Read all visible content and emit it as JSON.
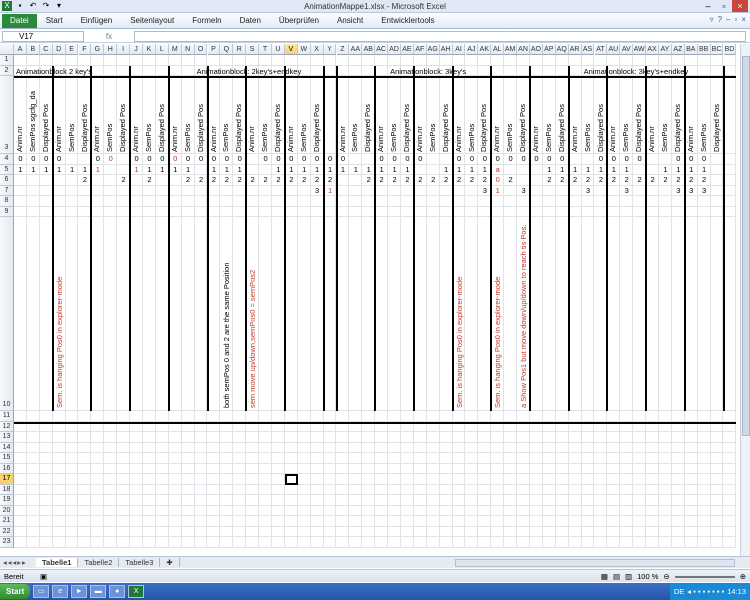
{
  "window": {
    "title": "AnimationMappe1.xlsx - Microsoft Excel"
  },
  "ribbon": {
    "file_label": "Datei",
    "tabs": [
      "Start",
      "Einfügen",
      "Seitenlayout",
      "Formeln",
      "Daten",
      "Überprüfen",
      "Ansicht",
      "Entwicklertools"
    ]
  },
  "formula_bar": {
    "name_box": "V17",
    "fx_label": "fx",
    "formula": ""
  },
  "sheet": {
    "selected_column": "V",
    "selected_row": "17",
    "columns": [
      "A",
      "B",
      "C",
      "D",
      "E",
      "F",
      "G",
      "H",
      "I",
      "J",
      "K",
      "L",
      "M",
      "N",
      "O",
      "P",
      "Q",
      "R",
      "S",
      "T",
      "U",
      "V",
      "W",
      "X",
      "Y",
      "Z",
      "AA",
      "AB",
      "AC",
      "AD",
      "AE",
      "AF",
      "AG",
      "AH",
      "AI",
      "AJ",
      "AK",
      "AL",
      "AM",
      "AN",
      "AO",
      "AP",
      "AQ",
      "AR",
      "AS",
      "AT",
      "AU",
      "AV",
      "AW",
      "AX",
      "AY",
      "AZ",
      "BA",
      "BB",
      "BC",
      "BD"
    ],
    "rows": [
      "1",
      "2",
      "3",
      "4",
      "5",
      "6",
      "7",
      "8",
      "9",
      "10",
      "11",
      "12",
      "13",
      "14",
      "15",
      "16",
      "17",
      "18",
      "19",
      "20",
      "21",
      "22",
      "23"
    ],
    "block_titles": [
      {
        "label": "Animationblock  2 key's"
      },
      {
        "label": "Animationblock: 2key's+endkey"
      },
      {
        "label": "Animationblock: 3key's"
      },
      {
        "label": "Animationblock: 3key's+endkey"
      }
    ],
    "header_labels": [
      "Anim.nr",
      "SemPos sgcfg_da",
      "Displayed Pos",
      "Anim.nr",
      "SemPos",
      "Displayed Pos",
      "Anim.nr",
      "SemPos",
      "Displayed Pos",
      "Anim.nr",
      "SemPos",
      "Displayed Pos",
      "Anim.nr",
      "SemPos",
      "Displayed Pos",
      "Anim.nr",
      "SemPos",
      "Displayed Pos",
      "Anim.nr",
      "SemPos",
      "Displayed Pos",
      "Anim.nr",
      "SemPos",
      "Displayed Pos",
      "Anim.nr",
      "SemPos",
      "Displayed Pos",
      "Anim.nr",
      "SemPos",
      "Displayed Pos",
      "Anim.nr",
      "SemPos",
      "Displayed Pos",
      "Anim.nr",
      "SemPos",
      "Displayed Pos",
      "Anim.nr",
      "SemPos",
      "Displayed Pos",
      "Anim.nr",
      "SemPos",
      "Displayed Pos",
      "Anim.nr",
      "SemPos",
      "Displayed Pos",
      "Anim.nr",
      "SemPos",
      "Displayed Pos",
      "Anim.nr",
      "SemPos",
      "Displayed Pos",
      "Anim.nr",
      "SemPos",
      "Displayed Pos"
    ],
    "notes": [
      {
        "text": "Sem. is hanging Pos0 in explorer-mode",
        "red": true
      },
      {
        "text": "both semPos 0 and 2  are the same Position",
        "red": false
      },
      {
        "text": "sem move up/down,semPos0 = semPos2",
        "red": true
      },
      {
        "text": "Sem. is hanging Pos0 in explorer-mode",
        "red": true
      },
      {
        "text": "Sem. is hanging Pos0 in explorer-mode",
        "red": true
      },
      {
        "text": "a   Show Pos1 but move down/up/down to reach tis Pos.",
        "red": true
      }
    ]
  },
  "sheet_tabs": [
    "Tabelle1",
    "Tabelle2",
    "Tabelle3"
  ],
  "status": {
    "ready": "Bereit",
    "zoom": "100 %"
  },
  "taskbar": {
    "start": "Start",
    "lang": "DE",
    "time": "14:13"
  }
}
